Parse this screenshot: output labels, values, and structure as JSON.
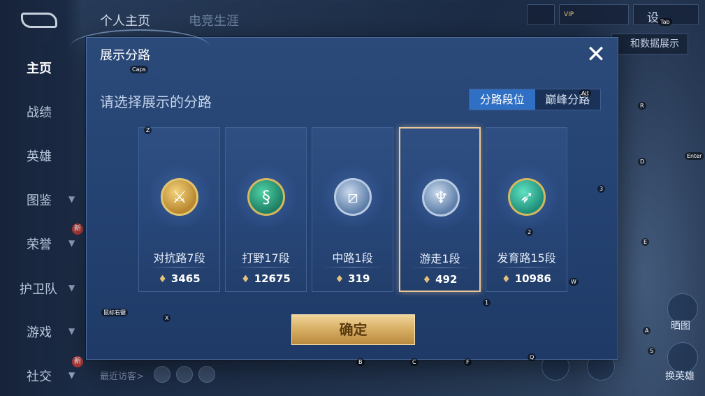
{
  "nav": {
    "side_items": [
      {
        "label": "主页",
        "active": true
      },
      {
        "label": "战绩"
      },
      {
        "label": "英雄"
      },
      {
        "label": "图鉴"
      },
      {
        "label": "荣誉"
      },
      {
        "label": "护卫队"
      },
      {
        "label": "游戏"
      },
      {
        "label": "社交"
      }
    ],
    "new_badge": "新",
    "top_tabs": [
      "个人主页",
      "电竞生涯"
    ],
    "settings": "设",
    "data_display": "和数据展示",
    "recent_visitors": "最近访客>",
    "vip": "VIP",
    "bottom_right_a": "晒图",
    "bottom_right_b": "换英雄"
  },
  "dialog": {
    "title": "展示分路",
    "subtitle": "请选择展示的分路",
    "tabs": [
      {
        "label": "分路段位",
        "active": true
      },
      {
        "label": "巅峰分路",
        "active": false
      }
    ],
    "cards": [
      {
        "label": "对抗路7段",
        "score": "3465",
        "emblem": "gold-sword-icon",
        "selected": false
      },
      {
        "label": "打野17段",
        "score": "12675",
        "emblem": "green-dragon-icon",
        "selected": false
      },
      {
        "label": "中路1段",
        "score": "319",
        "emblem": "silver-slash-icon",
        "selected": false
      },
      {
        "label": "游走1段",
        "score": "492",
        "emblem": "silver-wings-icon",
        "selected": true
      },
      {
        "label": "发育路15段",
        "score": "10986",
        "emblem": "teal-arrow-icon",
        "selected": false
      }
    ],
    "confirm": "确定"
  },
  "key_hints": [
    "Caps",
    "Z",
    "X",
    "Tab",
    "Alt",
    "R",
    "D",
    "Enter",
    "3",
    "E",
    "2",
    "W",
    "1",
    "A",
    "S",
    "Q",
    "B",
    "C",
    "F",
    "鼠标右键"
  ]
}
